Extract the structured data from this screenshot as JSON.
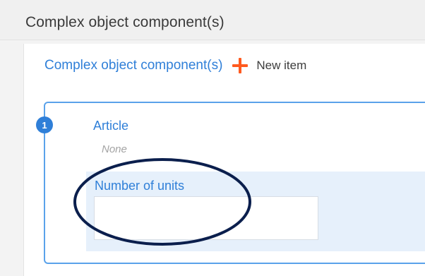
{
  "section": {
    "title": "Complex object component(s)"
  },
  "list": {
    "title": "Complex object component(s)",
    "new_item_label": "New item"
  },
  "item": {
    "number": "1",
    "article_label": "Article",
    "article_value": "None",
    "units_label": "Number of units",
    "units_value": ""
  },
  "colors": {
    "accent": "#2f7fd8",
    "plus": "#ff5a1f",
    "highlight": "#e6f0fb",
    "annotation": "#0b1f4d"
  },
  "icons": {
    "new_item": "plus-icon"
  }
}
